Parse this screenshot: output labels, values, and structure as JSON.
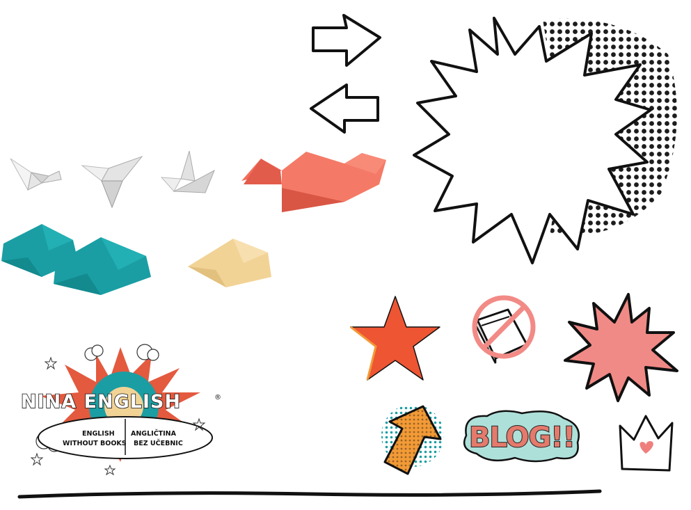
{
  "logo": {
    "title": "NINA ENGLISH",
    "registered_mark": "®",
    "tagline_en_line1": "ENGLISH",
    "tagline_en_line2": "WITHOUT BOOKS",
    "tagline_sk_line1": "ANGLIČTINA",
    "tagline_sk_line2": "BEZ UČEBNIC"
  },
  "blog_sticker": {
    "text": "BLOG!!"
  },
  "colors": {
    "coral": "#f26d5b",
    "teal": "#1a9ea3",
    "sand": "#f2d396",
    "star": "#ee5533",
    "burst": "#f08a86",
    "crown_heart": "#ef7f7d",
    "arrow_orange": "#f29a36",
    "halftone": "#111111"
  },
  "icons": [
    "origami-bird-icon",
    "origami-dove-icon",
    "origami-crane-icon",
    "origami-bird-coral-icon",
    "origami-bird-teal-icon",
    "origami-bird-sand-icon",
    "arrow-right-outline-icon",
    "arrow-left-outline-icon",
    "comic-speech-burst-icon",
    "star-icon",
    "no-books-icon",
    "pink-burst-icon",
    "up-arrow-sticker-icon",
    "blog-sticker-icon",
    "crown-heart-icon"
  ]
}
